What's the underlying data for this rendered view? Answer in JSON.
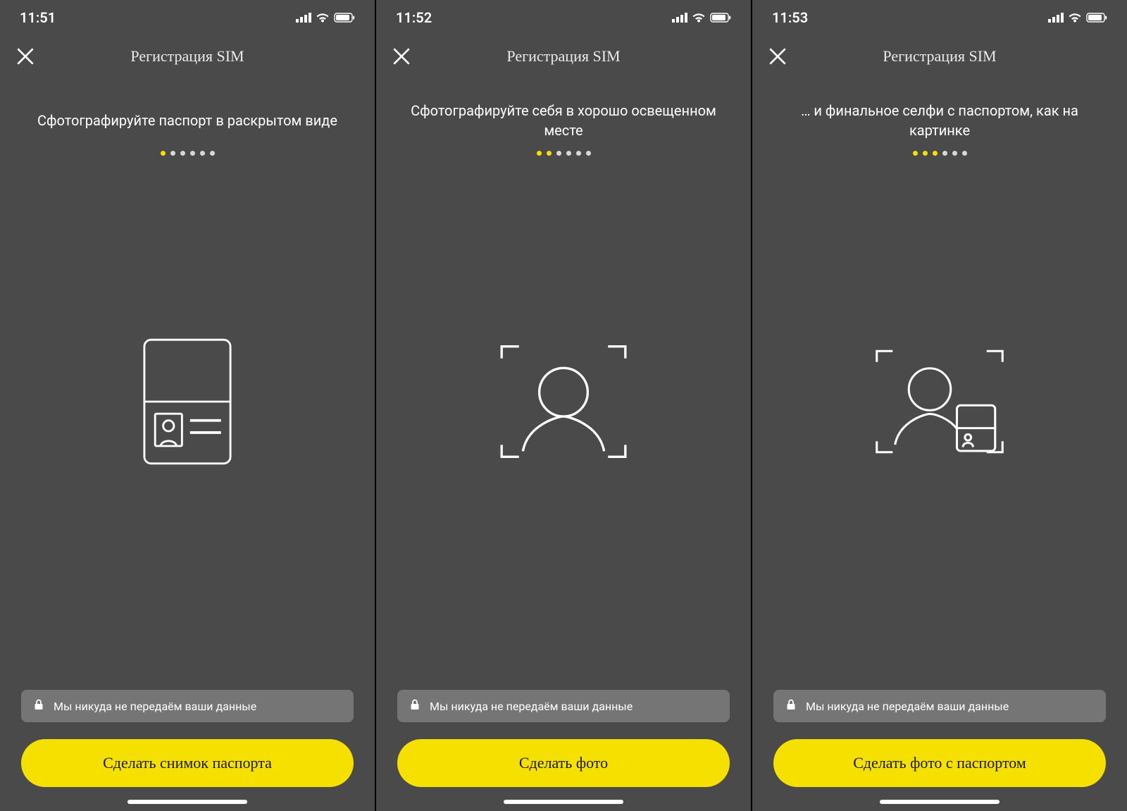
{
  "colors": {
    "accent": "#f6e000",
    "bg": "#4a4a4a"
  },
  "status": {
    "icons": [
      "signal-icon",
      "wifi-icon",
      "battery-icon"
    ]
  },
  "header": {
    "title": "Регистрация SIM"
  },
  "privacy": {
    "text": "Мы никуда не передаём ваши данные"
  },
  "progress": {
    "total": 6
  },
  "screens": [
    {
      "time": "11:51",
      "instruction": "Сфотографируйте паспорт в раскрытом виде",
      "active_dots": 1,
      "illustration": "passport-icon",
      "button_label": "Сделать снимок паспорта"
    },
    {
      "time": "11:52",
      "instruction": "Сфотографируйте себя в хорошо освещенном месте",
      "active_dots": 2,
      "illustration": "selfie-icon",
      "button_label": "Сделать фото"
    },
    {
      "time": "11:53",
      "instruction": "… и финальное селфи с паспортом, как на картинке",
      "active_dots": 3,
      "illustration": "selfie-with-passport-icon",
      "button_label": "Сделать фото с паспортом"
    }
  ]
}
